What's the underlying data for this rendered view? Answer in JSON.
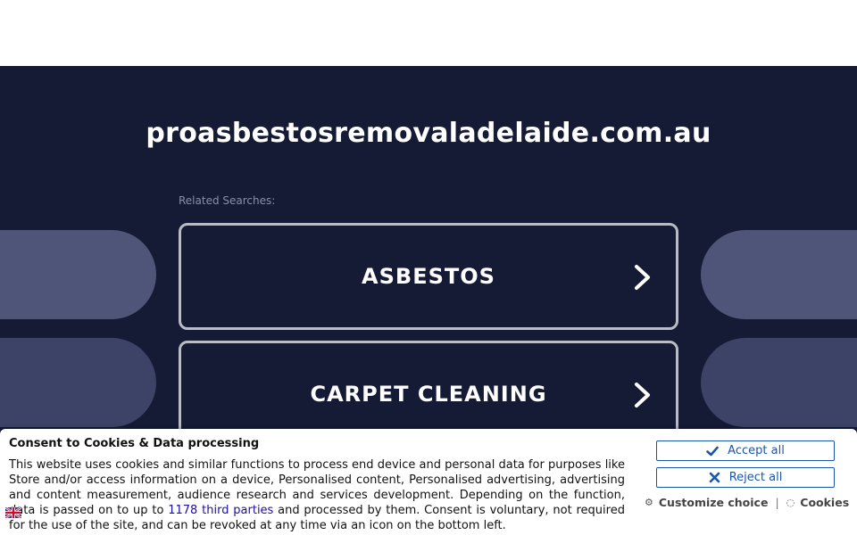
{
  "page": {
    "domain": "proasbestosremovaladelaide.com.au",
    "related_label": "Related Searches:"
  },
  "searches": [
    {
      "label": "ASBESTOS"
    },
    {
      "label": "CARPET CLEANING"
    }
  ],
  "consent": {
    "title": "Consent to Cookies & Data processing",
    "text_before_link": "This website uses cookies and similar functions to process end device and personal data for purposes like Store and/or access information on a device, Personalised content, Personalised advertising, advertising and content measurement, audience research and services development. Depending on the function, data is passed on to up to ",
    "link_text": "1178 third parties",
    "text_after_link": " and processed by them. Consent is voluntary, not required for the use of the site, and can be revoked at any time via an icon on the bottom left.",
    "accept_label": "Accept all",
    "reject_label": "Reject all",
    "customize_label": "Customize choice",
    "cookies_label": "Cookies",
    "separator": "|"
  },
  "colors": {
    "hero_bg": "#151a35",
    "button_accent": "#1a56a8"
  },
  "icons": {
    "chevron": "chevron-right-icon",
    "accept": "check-icon",
    "reject": "close-icon",
    "customize": "gear-icon",
    "cookies": "cookie-icon",
    "flag": "uk-flag-icon"
  }
}
